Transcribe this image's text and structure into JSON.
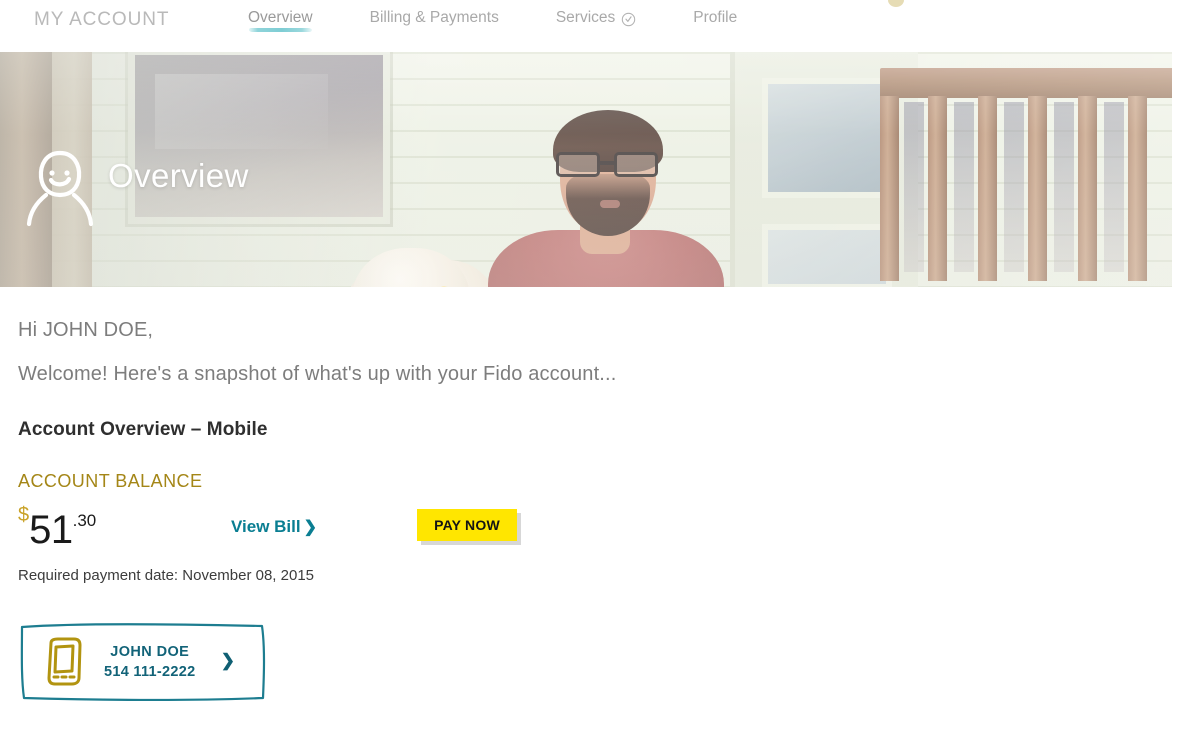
{
  "nav": {
    "brand": "MY ACCOUNT",
    "tabs": [
      {
        "label": "Overview",
        "active": true,
        "icon": null
      },
      {
        "label": "Billing & Payments",
        "active": false,
        "icon": null
      },
      {
        "label": "Services",
        "active": false,
        "icon": "check-circle-icon"
      },
      {
        "label": "Profile",
        "active": false,
        "icon": null
      }
    ]
  },
  "hero": {
    "title": "Overview",
    "icon": "smiley-person-icon",
    "photo_description": "man with beard and glasses looking at smartphone beside white dog eating yellow popsicle on a porch"
  },
  "main": {
    "greeting": "Hi JOHN DOE,",
    "welcome": "Welcome! Here's a snapshot of what's up with your Fido account...",
    "section_title": "Account Overview – Mobile",
    "balance_label": "ACCOUNT BALANCE",
    "balance": {
      "currency_symbol": "$",
      "dollars": "51",
      "cents": ".30"
    },
    "view_bill_label": "View Bill",
    "view_bill_chevron": "❯",
    "pay_now_label": "PAY NOW",
    "required_payment_date": "Required payment date: November 08, 2015"
  },
  "subscriber_card": {
    "icon": "mobile-phone-icon",
    "name": "JOHN DOE",
    "number": "514 111-2222",
    "chevron": "❯"
  },
  "colors": {
    "brand_gold": "#a48617",
    "accent_teal": "#0a7e92",
    "card_teal": "#126378",
    "pay_now_yellow": "#ffe600",
    "tab_underline": "#8fd4da",
    "body_text": "#7d7d7d",
    "heading_text": "#2f2f2f"
  }
}
